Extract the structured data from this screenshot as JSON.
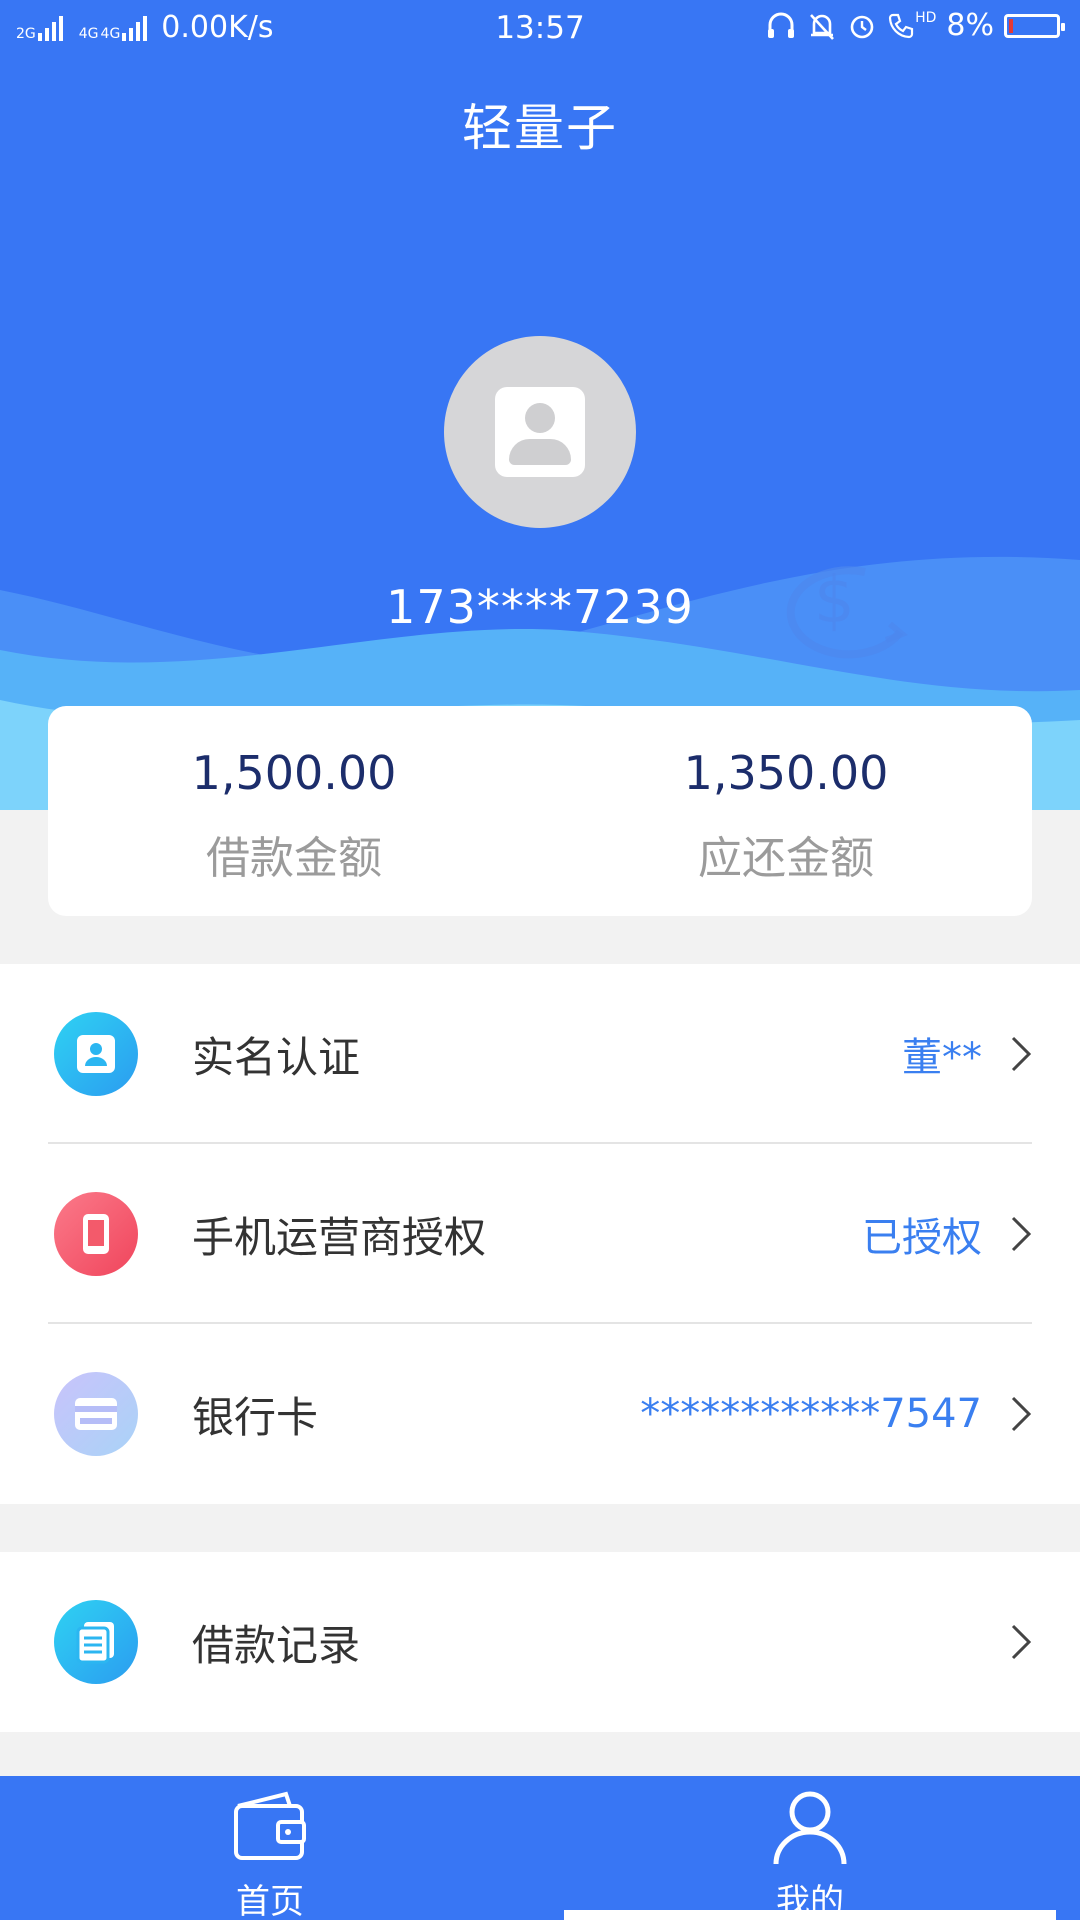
{
  "status_bar": {
    "net1": "2G",
    "net2": "4G",
    "net3": "4G",
    "speed": "0.00K/s",
    "time": "13:57",
    "hd": "HD",
    "battery": "8%"
  },
  "header": {
    "title": "轻量子"
  },
  "profile": {
    "phone": "173****7239"
  },
  "amounts": {
    "loan_value": "1,500.00",
    "loan_label": "借款金额",
    "repay_value": "1,350.00",
    "repay_label": "应还金额"
  },
  "menu": {
    "items": [
      {
        "label": "实名认证",
        "value": "董**",
        "icon": "id-card-icon"
      },
      {
        "label": "手机运营商授权",
        "value": "已授权",
        "icon": "mobile-phone-icon"
      },
      {
        "label": "银行卡",
        "value": "************7547",
        "icon": "bank-card-icon"
      }
    ],
    "records": {
      "label": "借款记录",
      "icon": "document-list-icon"
    }
  },
  "tabs": [
    {
      "label": "首页",
      "icon": "wallet-icon"
    },
    {
      "label": "我的",
      "icon": "user-icon"
    }
  ],
  "colors": {
    "primary": "#3876f4",
    "amount_text": "#1c2d6b",
    "value_text": "#3a7ff0"
  }
}
